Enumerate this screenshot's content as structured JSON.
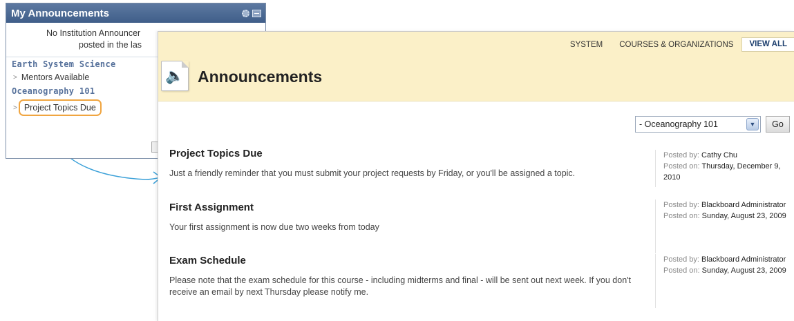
{
  "module": {
    "title": "My Announcements",
    "no_announcements_line1": "No Institution Announcer",
    "no_announcements_line2": "posted in the las",
    "courses": [
      {
        "name": "Earth System Science",
        "items": [
          "Mentors Available"
        ]
      },
      {
        "name": "Oceanography 101",
        "items": [
          "Project Topics Due"
        ]
      }
    ]
  },
  "tabs": {
    "system": "SYSTEM",
    "courses_orgs": "COURSES & ORGANIZATIONS",
    "view_all": "VIEW ALL"
  },
  "page": {
    "title": "Announcements",
    "filter_value": "- Oceanography 101",
    "go_label": "Go"
  },
  "announcements": [
    {
      "title": "Project Topics Due",
      "body": "Just a friendly reminder that you must submit your project requests by Friday, or you'll be assigned a topic.",
      "posted_by_label": "Posted by:",
      "posted_by": "Cathy Chu",
      "posted_on_label": "Posted on:",
      "posted_on": "Thursday, December 9, 2010"
    },
    {
      "title": "First Assignment",
      "body": "Your first assignment is now due two weeks from today",
      "posted_by_label": "Posted by:",
      "posted_by": "Blackboard Administrator",
      "posted_on_label": "Posted on:",
      "posted_on": "Sunday, August 23, 2009"
    },
    {
      "title": "Exam Schedule",
      "body": "Please note that the exam schedule for this course - including midterms and final - will be sent out next week. If you don't receive an email by next Thursday please notify me.",
      "posted_by_label": "Posted by:",
      "posted_by": "Blackboard Administrator",
      "posted_on_label": "Posted on:",
      "posted_on": "Sunday, August 23, 2009"
    }
  ],
  "colors": {
    "module_header": "#4a6891",
    "page_header_bg": "#fbf0c8",
    "highlight_ring": "#f0a540",
    "arrow": "#3aa0d8"
  },
  "icons": [
    "gear-icon",
    "minimize-icon",
    "speaker-icon",
    "dropdown-arrow-icon",
    "chevron-right-icon",
    "arrow-connector"
  ]
}
